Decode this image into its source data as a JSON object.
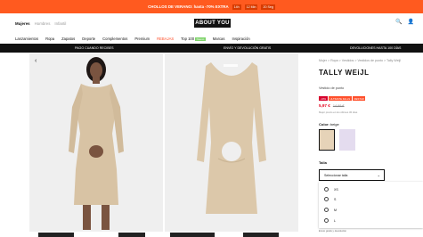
{
  "promo": {
    "text": "CHOLLOS DE VERANO: hasta -70% EXTRA",
    "countdown": [
      "14h",
      "12 Min",
      "20 Seg"
    ]
  },
  "header": {
    "tabs": [
      "Mujeres",
      "Hombres",
      "Infantil"
    ],
    "logo": "ABOUT YOU",
    "right_icons": [
      "search-icon",
      "user-icon"
    ]
  },
  "nav": {
    "items": [
      "Lanzamientos",
      "Ropa",
      "Zapatos",
      "Deporte",
      "Complementos",
      "Premium",
      "REBAJAS",
      "Top 100",
      "Marcas",
      "Inspiración"
    ],
    "sale_item": "REBAJAS",
    "badge": "Nuevo"
  },
  "benefits": [
    "PAGO CUANDO RECIBES",
    "ENVÍO Y DEVOLUCIÓN GRATIS",
    "DEVOLUCIONES HASTA 100 DÍAS"
  ],
  "product": {
    "breadcrumb": "Mujer > Ropa > Vestidos > Vestidos de punto > Tally Weijl",
    "brand": "TALLY WEiJL",
    "name": "Vestido de punto",
    "tags": [
      "-10%",
      "ULTIMATE FALLS",
      "RESTAR"
    ],
    "price_now": "5,97 €",
    "price_old": "14,99 €",
    "price_note": "Mejor precio en los últimos 30 días",
    "color_label": "Color:",
    "color_value": "beige",
    "size_label": "Talla",
    "size_placeholder": "Seleccionar talla",
    "sizes": [
      "XS",
      "S",
      "M",
      "L"
    ],
    "footer_note": "Envío gratis y devolución"
  }
}
